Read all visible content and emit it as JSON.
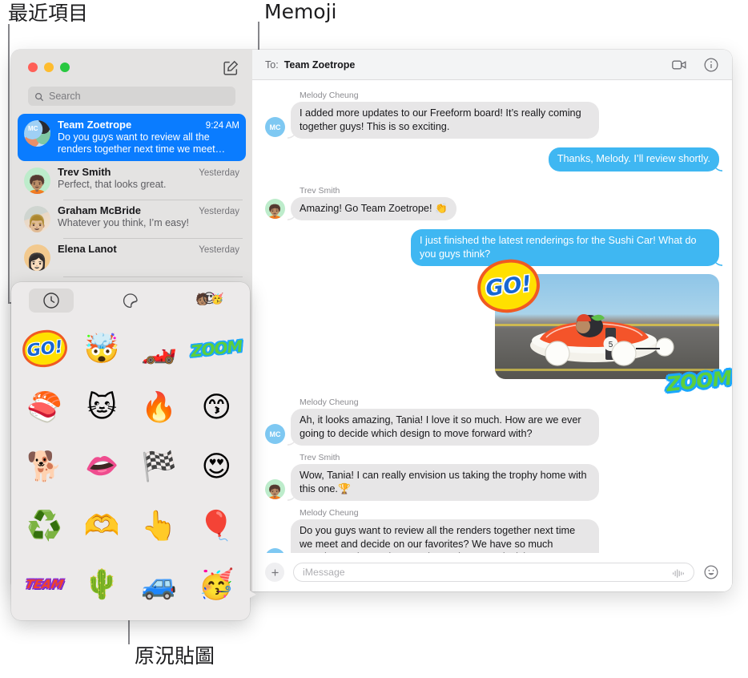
{
  "callouts": [
    {
      "id": "recents",
      "label": "最近項目"
    },
    {
      "id": "memoji",
      "label": "Memoji"
    },
    {
      "id": "live-stickers",
      "label": "原況貼圖"
    }
  ],
  "window": {
    "traffic_lights": {
      "close": "close-red",
      "minimize": "minimize-yellow",
      "zoom": "zoom-green"
    },
    "compose_icon": "compose-icon"
  },
  "sidebar": {
    "search": {
      "placeholder": "Search",
      "icon": "search-icon",
      "value": ""
    },
    "conversations": [
      {
        "name": "Team Zoetrope",
        "time": "9:24 AM",
        "preview": "Do you guys want to review all the renders together next time we meet…",
        "avatar": "group-avatar",
        "avatar_initials": "MC",
        "selected": true
      },
      {
        "name": "Trev Smith",
        "time": "Yesterday",
        "preview": "Perfect, that looks great.",
        "avatar": "memoji-avatar",
        "avatar_initials": "",
        "selected": false
      },
      {
        "name": "Graham McBride",
        "time": "Yesterday",
        "preview": "Whatever you think, I’m easy!",
        "avatar": "photo-avatar",
        "avatar_initials": "",
        "selected": false
      },
      {
        "name": "Elena Lanot",
        "time": "Yesterday",
        "preview": "",
        "avatar": "photo-avatar",
        "avatar_initials": "",
        "selected": false
      }
    ]
  },
  "conversation": {
    "to_label": "To:",
    "to_value": "Team Zoetrope",
    "facetime_icon": "video-camera-icon",
    "info_icon": "info-circle-icon",
    "messages": [
      {
        "sender": "Melody Cheung",
        "avatar_initials": "MC",
        "text": "I added more updates to our Freeform board! It’s really coming together guys! This is so exciting.",
        "direction": "in"
      },
      {
        "sender": "",
        "avatar_initials": "",
        "text": "Thanks, Melody. I’ll review shortly.",
        "direction": "out"
      },
      {
        "sender": "Trev Smith",
        "avatar_initials": "",
        "text": "Amazing! Go Team Zoetrope! 👏",
        "direction": "in"
      },
      {
        "sender": "",
        "avatar_initials": "",
        "text": "I just finished the latest renderings for the Sushi Car! What do you guys think?",
        "direction": "out"
      },
      {
        "sender": "Melody Cheung",
        "avatar_initials": "MC",
        "text": "Ah, it looks amazing, Tania! I love it so much. How are we ever going to decide which design to move forward with?",
        "direction": "in"
      },
      {
        "sender": "Trev Smith",
        "avatar_initials": "",
        "text": "Wow, Tania! I can really envision us taking the trophy home with this one.🏆",
        "direction": "in"
      },
      {
        "sender": "Melody Cheung",
        "avatar_initials": "MC",
        "text": "Do you guys want to review all the renders together next time we meet and decide on our favorites? We have so much amazing work now, just need to make some decisions.",
        "direction": "in"
      }
    ],
    "photo_attachment": {
      "description": "sushi-race-car-photo",
      "car_number": "5",
      "stickers": [
        {
          "name": "go-sticker",
          "text": "GO!"
        },
        {
          "name": "zoom-sticker",
          "text": "ZOOM"
        }
      ]
    }
  },
  "composer": {
    "add_icon": "plus-icon",
    "placeholder": "iMessage",
    "value": "",
    "audio_icon": "audio-waveform-icon",
    "emoji_icon": "smiley-face-icon"
  },
  "sticker_picker": {
    "tabs": [
      {
        "name": "recents-tab",
        "icon": "clock-icon",
        "selected": true
      },
      {
        "name": "live-stickers-tab",
        "icon": "sticker-peel-icon",
        "selected": false
      },
      {
        "name": "memoji-tab",
        "icon": "memoji-faces-icon",
        "glyph": "😍",
        "selected": false
      }
    ],
    "stickers": [
      {
        "name": "go-sticker",
        "kind": "text",
        "text": "GO!"
      },
      {
        "name": "mind-blown-memoji",
        "kind": "emoji",
        "glyph": "🤯"
      },
      {
        "name": "race-car-sticker",
        "kind": "emoji",
        "glyph": "🏎️"
      },
      {
        "name": "zoom-sticker",
        "kind": "text",
        "text": "ZOOM"
      },
      {
        "name": "sushi-sticker",
        "kind": "emoji",
        "glyph": "🍣"
      },
      {
        "name": "grumpy-cat-sticker",
        "kind": "emoji",
        "glyph": "🐱"
      },
      {
        "name": "flaming-car-sticker",
        "kind": "emoji",
        "glyph": "🔥"
      },
      {
        "name": "blowing-kiss-memoji",
        "kind": "emoji",
        "glyph": "😙"
      },
      {
        "name": "dog-sunglasses-sticker",
        "kind": "emoji",
        "glyph": "🐕"
      },
      {
        "name": "monster-mouth-sticker",
        "kind": "mouth",
        "glyph": "👄"
      },
      {
        "name": "checkered-flag-sticker",
        "kind": "emoji",
        "glyph": "🏁"
      },
      {
        "name": "heart-eyes-memoji",
        "kind": "emoji",
        "glyph": "😍"
      },
      {
        "name": "recycle-sticker",
        "kind": "emoji",
        "glyph": "♻️"
      },
      {
        "name": "heart-hands-memoji",
        "kind": "emoji",
        "glyph": "🫶"
      },
      {
        "name": "foam-finger-sticker",
        "kind": "emoji",
        "glyph": "👆"
      },
      {
        "name": "hot-air-balloon-sticker",
        "kind": "emoji",
        "glyph": "🎈"
      },
      {
        "name": "team-sticker",
        "kind": "text",
        "text": "TEAM"
      },
      {
        "name": "cactus-sticker",
        "kind": "emoji",
        "glyph": "🌵"
      },
      {
        "name": "blue-car-sticker",
        "kind": "emoji",
        "glyph": "🚙"
      },
      {
        "name": "party-memoji",
        "kind": "emoji",
        "glyph": "🥳"
      }
    ]
  }
}
